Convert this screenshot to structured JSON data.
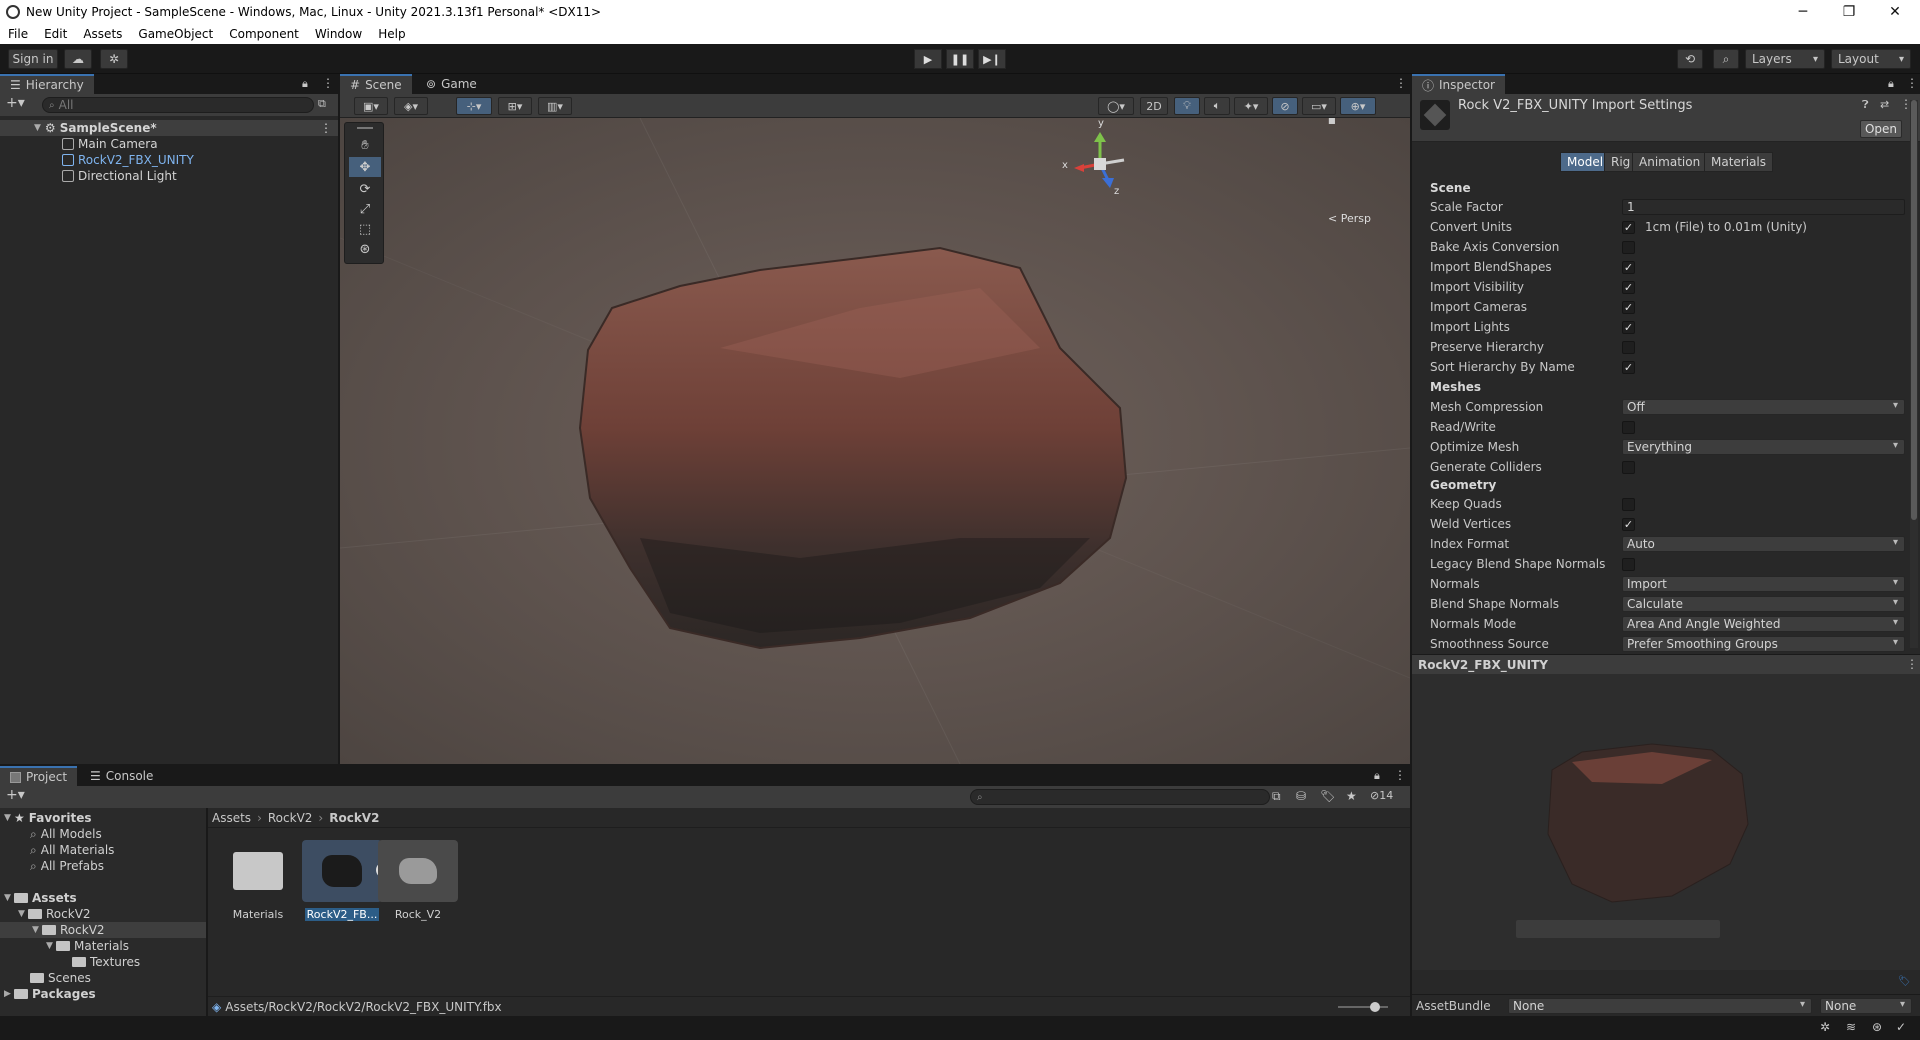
{
  "window": {
    "title": "New Unity Project - SampleScene - Windows, Mac, Linux - Unity 2021.3.13f1 Personal* <DX11>"
  },
  "menu": [
    "File",
    "Edit",
    "Assets",
    "GameObject",
    "Component",
    "Window",
    "Help"
  ],
  "toolbar": {
    "sign_in": "Sign in",
    "layers": "Layers",
    "layout": "Layout"
  },
  "hierarchy": {
    "tab": "Hierarchy",
    "search_placeholder": "All",
    "scene": "SampleScene*",
    "items": [
      "Main Camera",
      "RockV2_FBX_UNITY",
      "Directional Light"
    ]
  },
  "scene_view": {
    "tabs": [
      "Scene",
      "Game"
    ],
    "btn_2d": "2D",
    "persp": "< Persp",
    "axis_y": "y",
    "axis_x": "x",
    "axis_z": "z"
  },
  "inspector": {
    "tab": "Inspector",
    "header": "Rock V2_FBX_UNITY Import Settings",
    "open": "Open",
    "model_tabs": [
      "Model",
      "Rig",
      "Animation",
      "Materials"
    ],
    "sections": {
      "scene": "Scene",
      "meshes": "Meshes",
      "geometry": "Geometry"
    },
    "scale_factor_label": "Scale Factor",
    "scale_factor_value": "1",
    "convert_units_label": "Convert Units",
    "convert_units_note": "1cm (File) to 0.01m (Unity)",
    "bake_axis": "Bake Axis Conversion",
    "import_blendshapes": "Import BlendShapes",
    "import_visibility": "Import Visibility",
    "import_cameras": "Import Cameras",
    "import_lights": "Import Lights",
    "preserve_hierarchy": "Preserve Hierarchy",
    "sort_hierarchy": "Sort Hierarchy By Name",
    "mesh_compression_label": "Mesh Compression",
    "mesh_compression_value": "Off",
    "read_write": "Read/Write",
    "optimize_mesh_label": "Optimize Mesh",
    "optimize_mesh_value": "Everything",
    "generate_colliders": "Generate Colliders",
    "keep_quads": "Keep Quads",
    "weld_vertices": "Weld Vertices",
    "index_format_label": "Index Format",
    "index_format_value": "Auto",
    "legacy_blend": "Legacy Blend Shape Normals",
    "normals_label": "Normals",
    "normals_value": "Import",
    "blend_normals_label": "Blend Shape Normals",
    "blend_normals_value": "Calculate",
    "normals_mode_label": "Normals Mode",
    "normals_mode_value": "Area And Angle Weighted",
    "smoothness_label": "Smoothness Source",
    "smoothness_value": "Prefer Smoothing Groups",
    "preview_title": "RockV2_FBX_UNITY",
    "asset_bundle_label": "AssetBundle",
    "asset_bundle_value": "None",
    "asset_bundle_variant": "None"
  },
  "project": {
    "tabs": [
      "Project",
      "Console"
    ],
    "breadcrumb": [
      "Assets",
      "RockV2",
      "RockV2"
    ],
    "favorites": "Favorites",
    "fav_items": [
      "All Models",
      "All Materials",
      "All Prefabs"
    ],
    "assets": "Assets",
    "tree": [
      "RockV2",
      "RockV2",
      "Materials",
      "Textures",
      "Scenes"
    ],
    "packages": "Packages",
    "grid": [
      "Materials",
      "RockV2_FB...",
      "Rock_V2"
    ],
    "path": "Assets/RockV2/RockV2/RockV2_FBX_UNITY.fbx",
    "count": "14"
  }
}
